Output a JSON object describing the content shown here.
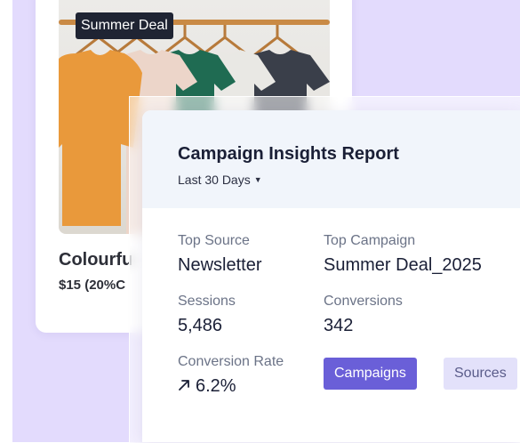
{
  "product": {
    "tag": "Summer Deal",
    "name": "Colourfu",
    "price": "$15 (20%C"
  },
  "report": {
    "title": "Campaign Insights Report",
    "period": "Last 30 Days",
    "metrics": {
      "top_source_label": "Top Source",
      "top_source_value": "Newsletter",
      "top_campaign_label": "Top Campaign",
      "top_campaign_value": "Summer Deal_2025",
      "sessions_label": "Sessions",
      "sessions_value": "5,486",
      "conversions_label": "Conversions",
      "conversions_value": "342",
      "conversion_rate_label": "Conversion Rate",
      "conversion_rate_value": "6.2%"
    },
    "buttons": {
      "campaigns": "Campaigns",
      "sources": "Sources"
    }
  },
  "colors": {
    "background": "#e3dbfd",
    "accent": "#6a5fd8",
    "accent_soft": "#e3e1fa",
    "header_bg": "#f1f5fb",
    "text_primary": "#1a1f36",
    "text_muted": "#6b7387"
  },
  "icons": {
    "trend": "arrow-up-right-icon",
    "dropdown": "caret-down-icon"
  }
}
